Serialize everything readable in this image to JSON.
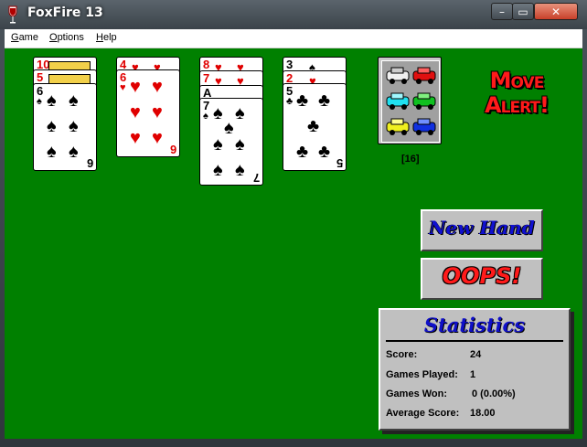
{
  "window": {
    "title": "FoxFire 13",
    "min_symbol": "–",
    "max_symbol": "▭",
    "close_symbol": "✕"
  },
  "menu": [
    {
      "key": "G",
      "rest": "ame"
    },
    {
      "key": "O",
      "rest": "ptions"
    },
    {
      "key": "H",
      "rest": "elp"
    }
  ],
  "piles": [
    {
      "peek": [
        "10",
        "5"
      ],
      "top": {
        "rank": "6",
        "suit": "♠",
        "color": "black"
      }
    },
    {
      "peek": [
        "4"
      ],
      "top": {
        "rank": "6",
        "suit": "♥",
        "color": "red"
      }
    },
    {
      "peek": [
        "8",
        "7",
        "A"
      ],
      "top": {
        "rank": "7",
        "suit": "♠",
        "color": "black"
      }
    },
    {
      "peek": [
        "3",
        "2"
      ],
      "top": {
        "rank": "5",
        "suit": "♣",
        "color": "black"
      }
    }
  ],
  "deck": {
    "count": "[16]"
  },
  "move_alert": {
    "line1": "Move",
    "line2": "Alert!"
  },
  "buttons": {
    "new_hand": "New Hand",
    "oops": "OOPS!"
  },
  "stats": {
    "title": "Statistics",
    "score_label": "Score:",
    "score": "24",
    "played_label": "Games Played:",
    "played": "1",
    "won_label": "Games Won:",
    "won": "0 (0.00%)",
    "avg_label": "Average Score:",
    "avg": "18.00"
  },
  "colors": {
    "felt": "#008000",
    "red": "#e00000",
    "accent_blue": "#1010d0"
  }
}
